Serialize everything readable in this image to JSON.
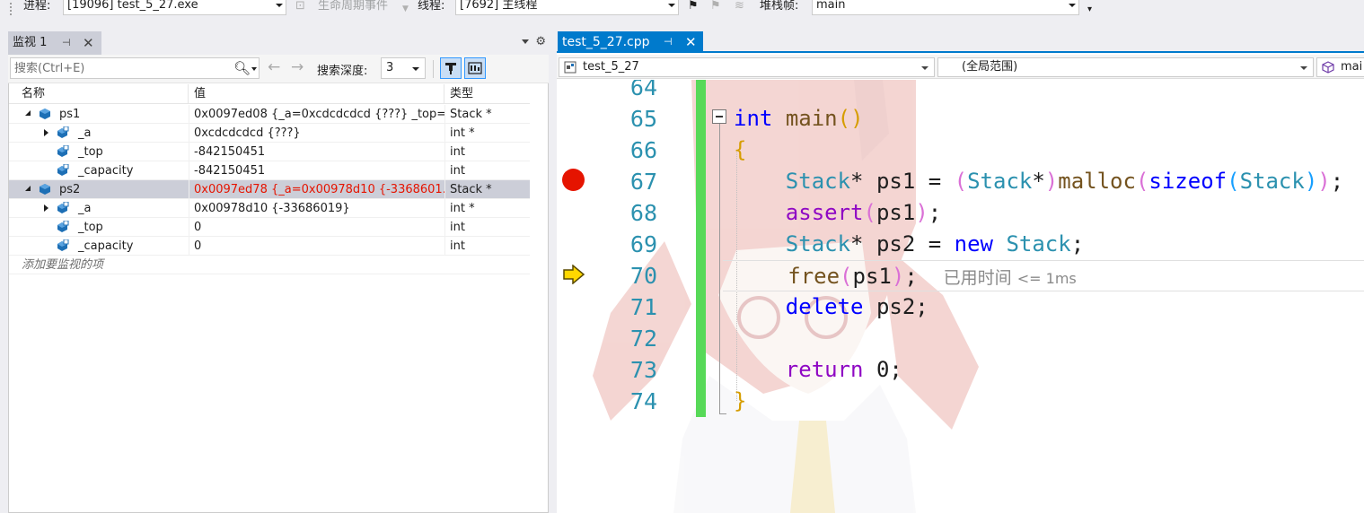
{
  "debug_toolbar": {
    "process_label": "进程:",
    "process_value": "[19096] test_5_27.exe",
    "lifecycle_label": "生命周期事件",
    "thread_label": "线程:",
    "thread_value": "[7692] 主线程",
    "stackframe_label": "堆栈帧:",
    "stackframe_value": "main"
  },
  "watch": {
    "tab_label": "监视 1",
    "search_placeholder": "搜索(Ctrl+E)",
    "depth_label": "搜索深度:",
    "depth_value": "3",
    "columns": {
      "name": "名称",
      "value": "值",
      "type": "类型"
    },
    "rows": [
      {
        "name": "ps1",
        "value": "0x0097ed08 {_a=0xcdcdcdcd {???} _top=...",
        "type": "Stack *"
      },
      {
        "name": "_a",
        "value": "0xcdcdcdcd {???}",
        "type": "int *"
      },
      {
        "name": "_top",
        "value": "-842150451",
        "type": "int"
      },
      {
        "name": "_capacity",
        "value": "-842150451",
        "type": "int"
      },
      {
        "name": "ps2",
        "value": "0x0097ed78 {_a=0x00978d10 {-3368601...",
        "type": "Stack *"
      },
      {
        "name": "_a",
        "value": "0x00978d10 {-33686019}",
        "type": "int *"
      },
      {
        "name": "_top",
        "value": "0",
        "type": "int"
      },
      {
        "name": "_capacity",
        "value": "0",
        "type": "int"
      }
    ],
    "add_watch_hint": "添加要监视的项"
  },
  "editor": {
    "tab_label": "test_5_27.cpp",
    "project_combo": "test_5_27",
    "scope_combo": "(全局范围)",
    "member_combo": "mai",
    "line_numbers": [
      "64",
      "65",
      "66",
      "67",
      "68",
      "69",
      "70",
      "71",
      "72",
      "73",
      "74"
    ],
    "code": {
      "l65_kw": "int",
      "l65_fn": "main",
      "l65_open": "(",
      "l65_close": ")",
      "l66": "{",
      "l67_t1": "Stack",
      "l67_a": "* ps1 = ",
      "l67_p1": "(",
      "l67_t2": "Stack",
      "l67_b": "*",
      "l67_p2": ")",
      "l67_fn": "malloc",
      "l67_p3": "(",
      "l67_kw": "sizeof",
      "l67_p4": "(",
      "l67_t3": "Stack",
      "l67_p5": ")",
      "l67_p6": ")",
      "l67_end": ";",
      "l68_fn": "assert",
      "l68_p1": "(",
      "l68_arg": "ps1",
      "l68_p2": ")",
      "l68_end": ";",
      "l69_t1": "Stack",
      "l69_a": "* ps2 = ",
      "l69_kw": "new",
      "l69_sp": " ",
      "l69_t2": "Stack",
      "l69_end": ";",
      "l70_fn": "free",
      "l70_p1": "(",
      "l70_arg": "ps1",
      "l70_p2": ")",
      "l70_end": ";",
      "l70_tip": "已用时间",
      "l70_tip_val": "<= 1ms",
      "l71_kw": "delete",
      "l71_rest": " ps2;",
      "l73_kw": "return",
      "l73_rest": " 0;",
      "l74": "}"
    }
  },
  "colors": {
    "accent": "#007acc",
    "breakpoint": "#e51400",
    "changed_value": "#e51400",
    "change_bar": "#57d958",
    "instruction_pointer": "#ffd800"
  }
}
